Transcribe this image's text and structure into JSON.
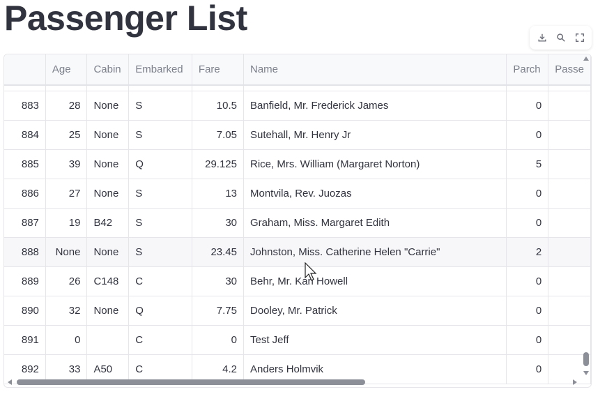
{
  "page": {
    "title": "Passenger List"
  },
  "toolbar": [
    {
      "name": "download-icon",
      "label": "Download"
    },
    {
      "name": "search-icon",
      "label": "Search"
    },
    {
      "name": "fullscreen-icon",
      "label": "Fullscreen"
    }
  ],
  "table": {
    "columns": [
      "",
      "Age",
      "Cabin",
      "Embarked",
      "Fare",
      "Name",
      "Parch",
      "Passe"
    ],
    "rows": [
      {
        "index": "883",
        "age": "28",
        "cabin": "None",
        "embarked": "S",
        "fare": "10.5",
        "name": "Banfield, Mr. Frederick James",
        "parch": "0"
      },
      {
        "index": "884",
        "age": "25",
        "cabin": "None",
        "embarked": "S",
        "fare": "7.05",
        "name": "Sutehall, Mr. Henry Jr",
        "parch": "0"
      },
      {
        "index": "885",
        "age": "39",
        "cabin": "None",
        "embarked": "Q",
        "fare": "29.125",
        "name": "Rice, Mrs. William (Margaret Norton)",
        "parch": "5"
      },
      {
        "index": "886",
        "age": "27",
        "cabin": "None",
        "embarked": "S",
        "fare": "13",
        "name": "Montvila, Rev. Juozas",
        "parch": "0"
      },
      {
        "index": "887",
        "age": "19",
        "cabin": "B42",
        "embarked": "S",
        "fare": "30",
        "name": "Graham, Miss. Margaret Edith",
        "parch": "0"
      },
      {
        "index": "888",
        "age": "None",
        "cabin": "None",
        "embarked": "S",
        "fare": "23.45",
        "name": "Johnston, Miss. Catherine Helen \"Carrie\"",
        "parch": "2"
      },
      {
        "index": "889",
        "age": "26",
        "cabin": "C148",
        "embarked": "C",
        "fare": "30",
        "name": "Behr, Mr. Karl Howell",
        "parch": "0"
      },
      {
        "index": "890",
        "age": "32",
        "cabin": "None",
        "embarked": "Q",
        "fare": "7.75",
        "name": "Dooley, Mr. Patrick",
        "parch": "0"
      },
      {
        "index": "891",
        "age": "0",
        "cabin": "",
        "embarked": "C",
        "fare": "0",
        "name": "Test Jeff",
        "parch": "0"
      },
      {
        "index": "892",
        "age": "33",
        "cabin": "A50",
        "embarked": "C",
        "fare": "4.2",
        "name": "Anders Holmvik",
        "parch": "0"
      }
    ],
    "hovered_row": "888"
  },
  "colors": {
    "text": "#31333f",
    "muted": "#9a9ca6",
    "border": "#e6e6ea",
    "header_bg": "#f8f9fb"
  }
}
